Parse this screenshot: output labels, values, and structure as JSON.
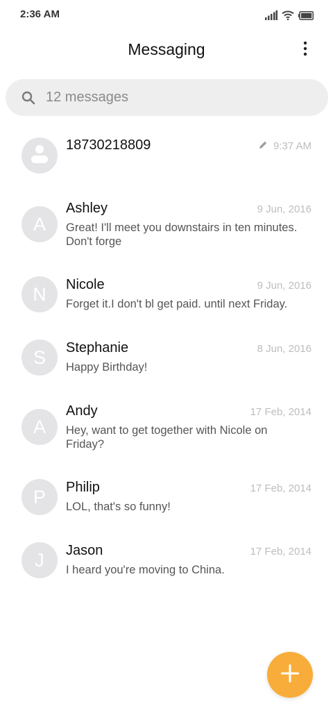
{
  "status_bar": {
    "time": "2:36 AM",
    "icons": [
      "signal-icon",
      "wifi-icon",
      "battery-icon"
    ]
  },
  "header": {
    "title": "Messaging",
    "more_icon": "more-vertical-icon"
  },
  "search": {
    "placeholder": "12 messages",
    "icon": "search-icon"
  },
  "conversations": [
    {
      "name": "18730218809",
      "time": "9:37 AM",
      "preview": "",
      "avatar_letter": "",
      "avatar_icon": "person-icon",
      "draft_icon": "pencil-icon"
    },
    {
      "name": "Ashley",
      "time": "9 Jun, 2016",
      "preview": "Great! I'll meet you downstairs in ten minutes. Don't forge",
      "avatar_letter": "A"
    },
    {
      "name": "Nicole",
      "time": "9 Jun, 2016",
      "preview": "Forget it.I don't bl get paid. until next Friday.",
      "avatar_letter": "N"
    },
    {
      "name": "Stephanie",
      "time": "8 Jun, 2016",
      "preview": "Happy Birthday!",
      "avatar_letter": "S"
    },
    {
      "name": "Andy",
      "time": "17 Feb, 2014",
      "preview": "Hey, want to get together with Nicole on Friday?",
      "avatar_letter": "A"
    },
    {
      "name": "Philip",
      "time": "17 Feb, 2014",
      "preview": "LOL, that's so funny!",
      "avatar_letter": "P"
    },
    {
      "name": "Jason",
      "time": "17 Feb, 2014",
      "preview": "I heard you're moving to China.",
      "avatar_letter": "J"
    }
  ],
  "fab": {
    "icon": "plus-icon",
    "color": "#f8ad3a"
  },
  "colors": {
    "accent": "#f8ad3a",
    "avatar_bg": "#e4e4e6",
    "timestamp": "#bdbdbd",
    "search_bg": "#eeeeee"
  }
}
